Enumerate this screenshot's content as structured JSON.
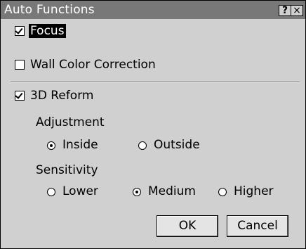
{
  "window": {
    "title": "Auto Functions",
    "help_label": "?",
    "close_label": "×"
  },
  "options": {
    "focus": {
      "label": "Focus",
      "checked": true
    },
    "wall_color": {
      "label": "Wall Color Correction",
      "checked": false
    },
    "reform": {
      "label": "3D Reform",
      "checked": true
    }
  },
  "adjustment": {
    "heading": "Adjustment",
    "options": [
      {
        "label": "Inside",
        "selected": true
      },
      {
        "label": "Outside",
        "selected": false
      }
    ]
  },
  "sensitivity": {
    "heading": "Sensitivity",
    "options": [
      {
        "label": "Lower",
        "selected": false
      },
      {
        "label": "Medium",
        "selected": true
      },
      {
        "label": "Higher",
        "selected": false
      }
    ]
  },
  "buttons": {
    "ok": "OK",
    "cancel": "Cancel"
  }
}
